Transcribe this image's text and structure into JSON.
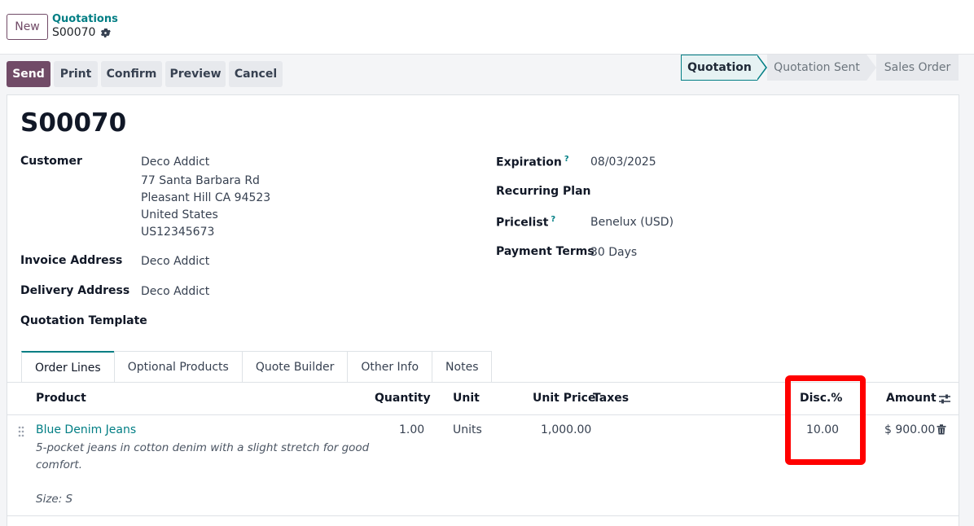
{
  "header": {
    "new_label": "New",
    "breadcrumb_parent": "Quotations",
    "breadcrumb_current": "S00070"
  },
  "actions": {
    "send": "Send",
    "print": "Print",
    "confirm": "Confirm",
    "preview": "Preview",
    "cancel": "Cancel"
  },
  "status_stages": [
    "Quotation",
    "Quotation Sent",
    "Sales Order"
  ],
  "status_active": "Quotation",
  "form": {
    "title": "S00070",
    "customer_label": "Customer",
    "customer_name": "Deco Addict",
    "customer_address": [
      "77 Santa Barbara Rd",
      "Pleasant Hill CA 94523",
      "United States",
      "US12345673"
    ],
    "invoice_address_label": "Invoice Address",
    "invoice_address": "Deco Addict",
    "delivery_address_label": "Delivery Address",
    "delivery_address": "Deco Addict",
    "quotation_template_label": "Quotation Template",
    "expiration_label": "Expiration",
    "expiration": "08/03/2025",
    "recurring_plan_label": "Recurring Plan",
    "pricelist_label": "Pricelist",
    "pricelist": "Benelux (USD)",
    "payment_terms_label": "Payment Terms",
    "payment_terms": "30 Days",
    "help_marker": "?"
  },
  "tabs": [
    "Order Lines",
    "Optional Products",
    "Quote Builder",
    "Other Info",
    "Notes"
  ],
  "table": {
    "headers": {
      "product": "Product",
      "quantity": "Quantity",
      "unit": "Unit",
      "unit_price": "Unit Price",
      "taxes": "Taxes",
      "disc": "Disc.%",
      "amount": "Amount"
    },
    "rows": [
      {
        "product": "Blue Denim Jeans",
        "description_line1": "5-pocket jeans in cotton denim with a slight stretch for good",
        "description_line2": "comfort.",
        "size": "Size: S",
        "quantity": "1.00",
        "unit": "Units",
        "unit_price": "1,000.00",
        "taxes": "",
        "disc": "10.00",
        "amount": "$ 900.00"
      }
    ]
  },
  "colors": {
    "brand": "#714b67",
    "accent": "#017e84",
    "highlight": "#ff0000"
  },
  "icons": {
    "gear": "gear-icon",
    "settings": "column-settings-icon",
    "trash": "trash-icon",
    "drag": "drag-handle-icon"
  }
}
